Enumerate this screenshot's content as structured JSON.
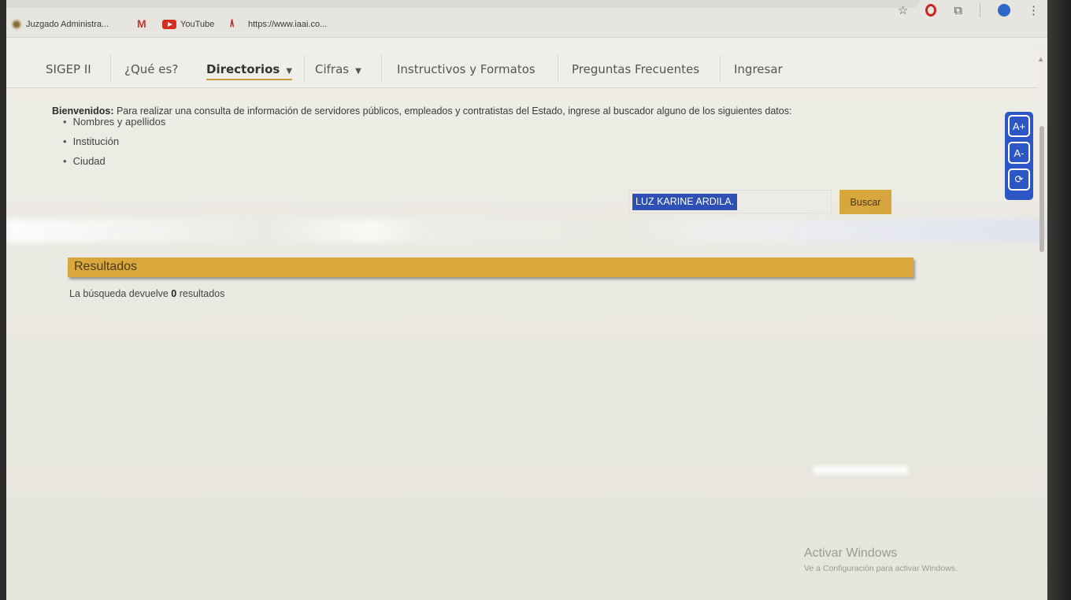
{
  "bookmarks": [
    {
      "label": "Juzgado Administra...",
      "icon": "court-icon"
    },
    {
      "label": "",
      "icon": "gmail-icon"
    },
    {
      "label": "YouTube",
      "icon": "youtube-icon"
    },
    {
      "label": "https://www.iaai.co...",
      "icon": "iaai-icon"
    }
  ],
  "nav": {
    "sigep": "SIGEP II",
    "que_es": "¿Qué es?",
    "directorios": "Directorios",
    "cifras": "Cifras",
    "instructivos": "Instructivos y Formatos",
    "preguntas": "Preguntas Frecuentes",
    "ingresar": "Ingresar"
  },
  "welcome": {
    "bold": "Bienvenidos:",
    "text": " Para realizar una consulta de información de servidores públicos, empleados y contratistas del Estado, ingrese al buscador alguno de los siguientes datos:",
    "items": [
      "Nombres y apellidos",
      "Institución",
      "Ciudad"
    ]
  },
  "search": {
    "value": "LUZ KARINE ARDILA.",
    "button": "Buscar"
  },
  "a11y": {
    "increase": "A+",
    "decrease": "A-",
    "reset": "⟳"
  },
  "results": {
    "title": "Resultados",
    "prefix": "La búsqueda devuelve ",
    "count": "0",
    "suffix": " resultados"
  },
  "windows_watermark": {
    "title": "Activar Windows",
    "subtitle": "Ve a Configuración para activar Windows."
  },
  "colors": {
    "accent": "#d9a73c",
    "a11y_blue": "#2b56c4",
    "selection": "#2e4fb3"
  }
}
